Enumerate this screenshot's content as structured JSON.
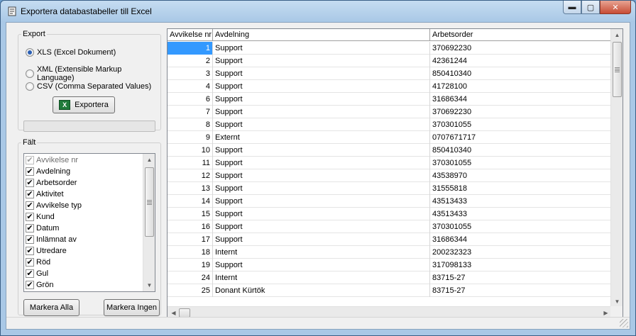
{
  "window": {
    "title": "Exportera databastabeller till Excel",
    "controls": {
      "minimize": "▬",
      "maximize": "▢",
      "close": "✕"
    }
  },
  "export": {
    "legend": "Export",
    "options": [
      {
        "label": "XLS (Excel Dokument)",
        "selected": true
      },
      {
        "label": "XML (Extensible Markup Language)",
        "selected": false
      },
      {
        "label": "CSV (Comma Separated Values)",
        "selected": false
      }
    ],
    "button_label": "Exportera",
    "progress": 0
  },
  "falt": {
    "legend": "Fält",
    "items": [
      {
        "label": "Avvikelse nr",
        "checked": true,
        "disabled": true
      },
      {
        "label": "Avdelning",
        "checked": true
      },
      {
        "label": "Arbetsorder",
        "checked": true
      },
      {
        "label": "Aktivitet",
        "checked": true
      },
      {
        "label": "Avvikelse typ",
        "checked": true
      },
      {
        "label": "Kund",
        "checked": true
      },
      {
        "label": "Datum",
        "checked": true
      },
      {
        "label": "Inlämnat av",
        "checked": true
      },
      {
        "label": "Utredare",
        "checked": true
      },
      {
        "label": "Röd",
        "checked": true
      },
      {
        "label": "Gul",
        "checked": true
      },
      {
        "label": "Grön",
        "checked": true
      }
    ],
    "select_all_label": "Markera Alla",
    "select_none_label": "Markera Ingen"
  },
  "table": {
    "columns": [
      "Avvikelse nr",
      "Avdelning",
      "Arbetsorder"
    ],
    "rows": [
      [
        "1",
        "Support",
        "370692230"
      ],
      [
        "2",
        "Support",
        "42361244"
      ],
      [
        "3",
        "Support",
        "850410340"
      ],
      [
        "4",
        "Support",
        "41728100"
      ],
      [
        "6",
        "Support",
        "31686344"
      ],
      [
        "7",
        "Support",
        "370692230"
      ],
      [
        "8",
        "Support",
        "370301055"
      ],
      [
        "9",
        "Externt",
        "0707671717"
      ],
      [
        "10",
        "Support",
        "850410340"
      ],
      [
        "11",
        "Support",
        "370301055"
      ],
      [
        "12",
        "Support",
        "43538970"
      ],
      [
        "13",
        "Support",
        "31555818"
      ],
      [
        "14",
        "Support",
        "43513433"
      ],
      [
        "15",
        "Support",
        "43513433"
      ],
      [
        "16",
        "Support",
        "370301055"
      ],
      [
        "17",
        "Support",
        "31686344"
      ],
      [
        "18",
        "Internt",
        "200232323"
      ],
      [
        "19",
        "Support",
        "317098133"
      ],
      [
        "24",
        "Internt",
        "83715-27"
      ],
      [
        "25",
        "Donant Kürtök",
        "83715-27"
      ]
    ],
    "selected_row": 0
  },
  "colors": {
    "selection": "#3399ff",
    "progress": "#06b025",
    "frame": "#a9c8e6"
  }
}
